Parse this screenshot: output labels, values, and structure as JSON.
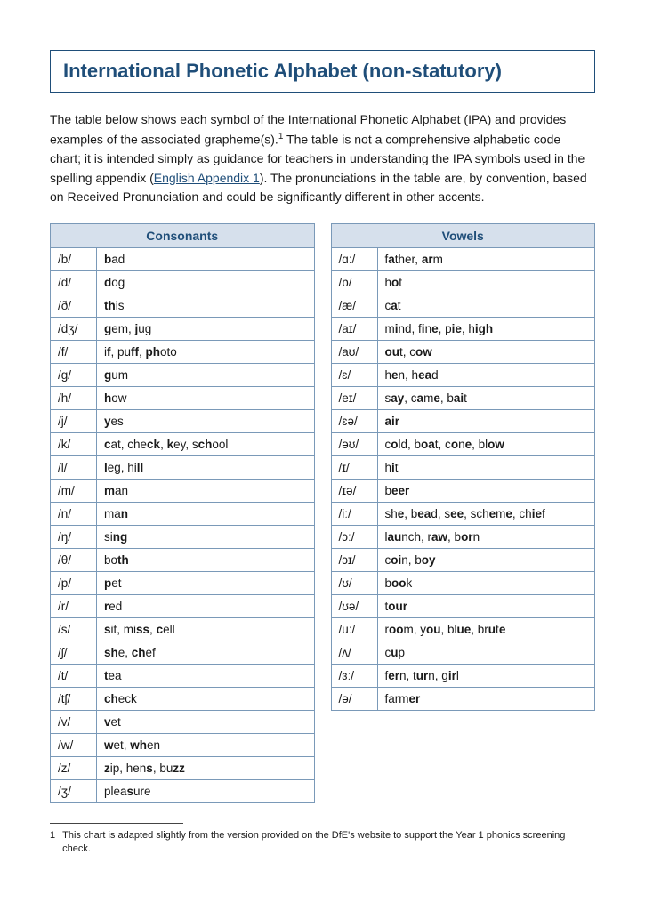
{
  "title": "International Phonetic Alphabet (non-statutory)",
  "intro": {
    "p1a": "The table below shows each symbol of the International Phonetic Alphabet (IPA) and provides examples of the associated grapheme(s).",
    "p1b": " The table is not a comprehensive alphabetic code chart; it is intended simply as guidance for teachers in understanding the IPA symbols used in the spelling appendix (",
    "link": "English Appendix 1",
    "p1c": "). The pronunciations in the table are, by convention, based on Received Pronunciation and could be significantly different in other accents.",
    "sup": "1"
  },
  "consonants_header": "Consonants",
  "vowels_header": "Vowels",
  "consonants": [
    {
      "sym": "/b/",
      "ex": "<b>b</b>ad"
    },
    {
      "sym": "/d/",
      "ex": "<b>d</b>og"
    },
    {
      "sym": "/ð/",
      "ex": "<b>th</b>is"
    },
    {
      "sym": "/dʒ/",
      "ex": "<b>g</b>em, <b>j</b>ug"
    },
    {
      "sym": "/f/",
      "ex": "i<b>f</b>, pu<b>ff</b>, <b>ph</b>oto"
    },
    {
      "sym": "/g/",
      "ex": "<b>g</b>um"
    },
    {
      "sym": "/h/",
      "ex": "<b>h</b>ow"
    },
    {
      "sym": "/j/",
      "ex": "<b>y</b>es"
    },
    {
      "sym": "/k/",
      "ex": "<b>c</b>at, che<b>ck</b>, <b>k</b>ey, s<b>ch</b>ool"
    },
    {
      "sym": "/l/",
      "ex": "<b>l</b>eg, hi<b>ll</b>"
    },
    {
      "sym": "/m/",
      "ex": "<b>m</b>an"
    },
    {
      "sym": "/n/",
      "ex": "ma<b>n</b>"
    },
    {
      "sym": "/ŋ/",
      "ex": "si<b>ng</b>"
    },
    {
      "sym": "/θ/",
      "ex": "bo<b>th</b>"
    },
    {
      "sym": "/p/",
      "ex": "<b>p</b>et"
    },
    {
      "sym": "/r/",
      "ex": "<b>r</b>ed"
    },
    {
      "sym": "/s/",
      "ex": "<b>s</b>it, mi<b>ss</b>, <b>c</b>ell"
    },
    {
      "sym": "/ʃ/",
      "ex": "<b>sh</b>e, <b>ch</b>ef"
    },
    {
      "sym": "/t/",
      "ex": "<b>t</b>ea"
    },
    {
      "sym": "/tʃ/",
      "ex": "<b>ch</b>eck"
    },
    {
      "sym": "/v/",
      "ex": "<b>v</b>et"
    },
    {
      "sym": "/w/",
      "ex": "<b>w</b>et, <b>wh</b>en"
    },
    {
      "sym": "/z/",
      "ex": "<b>z</b>ip, hen<b>s</b>, bu<b>zz</b>"
    },
    {
      "sym": "/ʒ/",
      "ex": "plea<b>s</b>ure"
    }
  ],
  "vowels": [
    {
      "sym": "/ɑː/",
      "ex": "f<b>a</b>ther, <b>ar</b>m"
    },
    {
      "sym": "/ɒ/",
      "ex": "h<b>o</b>t"
    },
    {
      "sym": "/æ/",
      "ex": "c<b>a</b>t"
    },
    {
      "sym": "/aɪ/",
      "ex": "m<b>i</b>nd, f<b>i</b>n<b>e</b>, p<b>ie</b>, h<b>igh</b>"
    },
    {
      "sym": "/aʊ/",
      "ex": "<b>ou</b>t, c<b>ow</b>"
    },
    {
      "sym": "/ɛ/",
      "ex": "h<b>e</b>n, h<b>ea</b>d"
    },
    {
      "sym": "/eɪ/",
      "ex": "s<b>ay</b>, c<b>a</b>m<b>e</b>, b<b>ai</b>t"
    },
    {
      "sym": "/ɛə/",
      "ex": "<b>air</b>"
    },
    {
      "sym": "/əʊ/",
      "ex": "c<b>o</b>ld, b<b>oa</b>t, c<b>o</b>n<b>e</b>, bl<b>ow</b>"
    },
    {
      "sym": "/ɪ/",
      "ex": "h<b>i</b>t"
    },
    {
      "sym": "/ɪə/",
      "ex": "b<b>eer</b>"
    },
    {
      "sym": "/iː/",
      "ex": "sh<b>e</b>, b<b>ea</b>d, s<b>ee</b>, sch<b>e</b>m<b>e</b>, ch<b>ie</b>f"
    },
    {
      "sym": "/ɔː/",
      "ex": "l<b>au</b>nch, r<b>aw</b>, b<b>or</b>n"
    },
    {
      "sym": "/ɔɪ/",
      "ex": "c<b>oi</b>n, b<b>oy</b>"
    },
    {
      "sym": "/ʊ/",
      "ex": "b<b>oo</b>k"
    },
    {
      "sym": "/ʊə/",
      "ex": "t<b>our</b>"
    },
    {
      "sym": "/uː/",
      "ex": "r<b>oo</b>m, y<b>ou</b>, bl<b>ue</b>, br<b>u</b>t<b>e</b>"
    },
    {
      "sym": "/ʌ/",
      "ex": "c<b>u</b>p"
    },
    {
      "sym": "/ɜː/",
      "ex": "f<b>er</b>n, t<b>ur</b>n, g<b>ir</b>l"
    },
    {
      "sym": "/ə/",
      "ex": "farm<b>er</b>"
    }
  ],
  "footnote": {
    "num": "1",
    "text": "This chart is adapted slightly from the version provided on the DfE's website to support the Year 1 phonics screening check."
  }
}
